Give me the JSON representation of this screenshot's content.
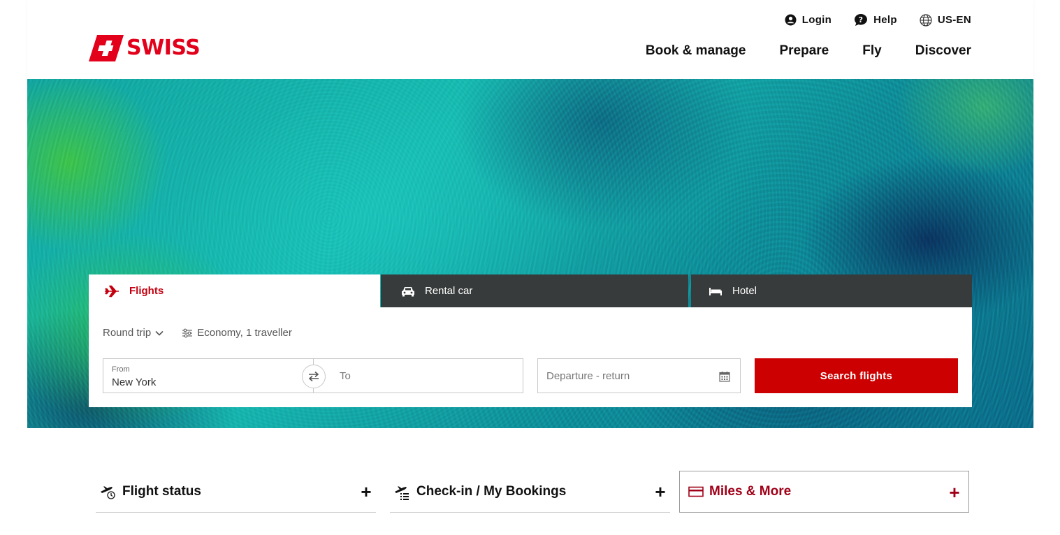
{
  "brand": {
    "name": "SWISS",
    "color": "#e2001a"
  },
  "utility_nav": {
    "login": "Login",
    "help": "Help",
    "language": "US-EN"
  },
  "main_nav": [
    "Book & manage",
    "Prepare",
    "Fly",
    "Discover"
  ],
  "booking": {
    "tabs": {
      "flights": "Flights",
      "rental_car": "Rental car",
      "hotel": "Hotel"
    },
    "trip_type": "Round trip",
    "cabin_travellers": "Economy, 1 traveller",
    "from_label": "From",
    "from_value": "New York",
    "to_placeholder": "To",
    "dates_placeholder": "Departure - return",
    "search_label": "Search flights",
    "accent_color": "#cc0000"
  },
  "quick_links": {
    "flight_status": "Flight status",
    "checkin": "Check-in / My Bookings",
    "miles": "Miles & More",
    "expand_symbol": "+"
  },
  "icons": {
    "login": "user-circle-icon",
    "help": "help-bubble-icon",
    "language": "globe-icon",
    "flights": "airplane-icon",
    "rental_car": "car-icon",
    "hotel": "bed-icon",
    "trip_type": "chevron-down-icon",
    "cabin": "sliders-icon",
    "swap": "swap-arrows-icon",
    "dates": "calendar-icon",
    "flight_status": "plane-clock-icon",
    "checkin": "plane-list-icon",
    "miles": "card-icon"
  }
}
